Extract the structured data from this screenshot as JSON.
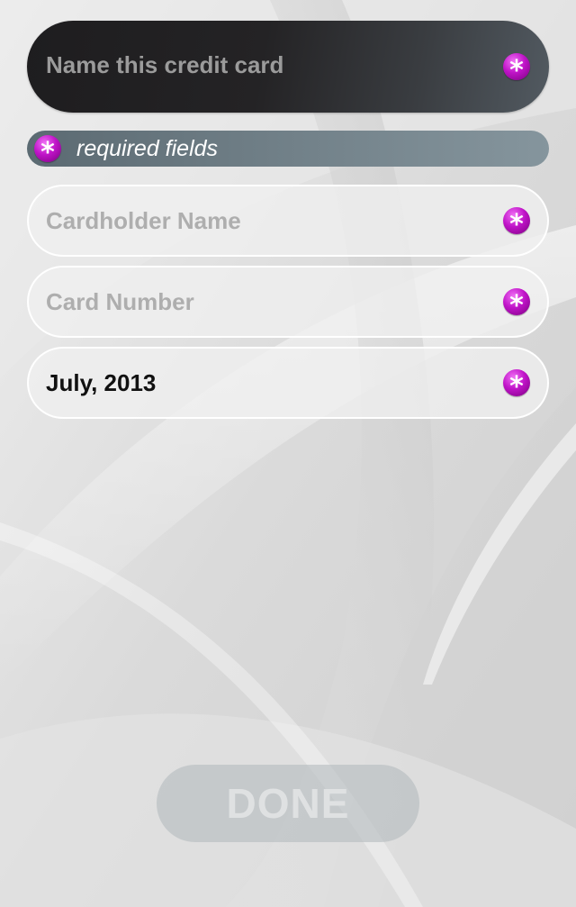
{
  "form": {
    "card_name_placeholder": "Name this credit card",
    "required_note": "required fields",
    "required_symbol": "*",
    "fields": [
      {
        "placeholder": "Cardholder Name",
        "value": ""
      },
      {
        "placeholder": "Card Number",
        "value": ""
      },
      {
        "placeholder": "",
        "value": "July, 2013"
      }
    ]
  },
  "actions": {
    "done_label": "DONE"
  },
  "colors": {
    "accent_magenta": "#c014c8",
    "title_bar": "#242325",
    "required_banner": "#6d7c84",
    "placeholder_text": "#aeaeae"
  }
}
